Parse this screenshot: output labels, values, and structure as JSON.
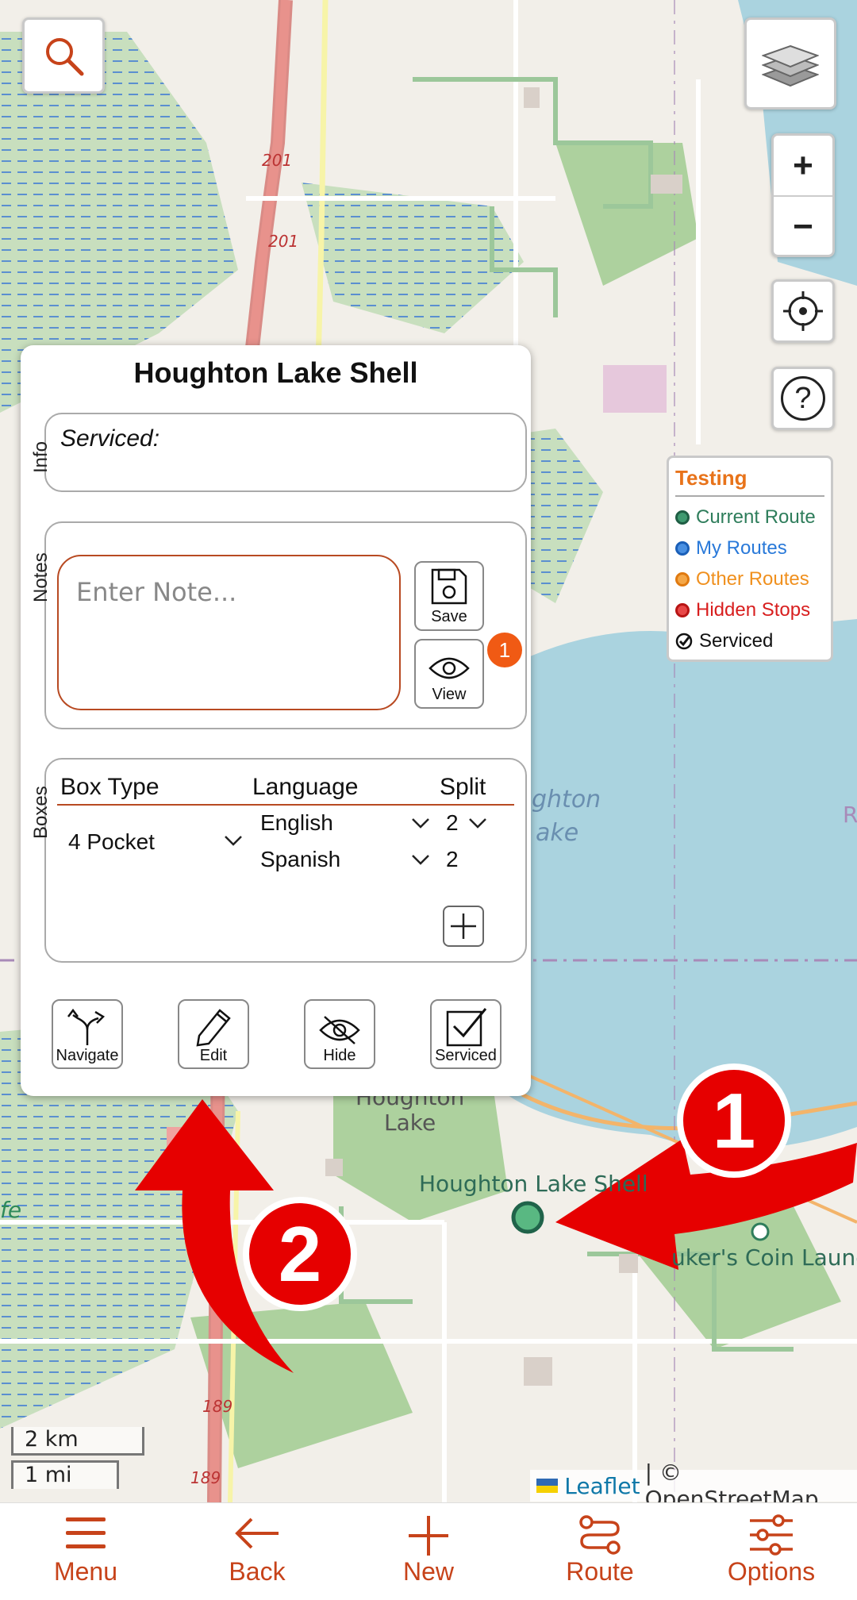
{
  "map": {
    "labels": {
      "place": "Houghton Lake Shell",
      "laundry": "uker's Coin Laundr",
      "lake1": "ghton",
      "lake2": "ake",
      "town1": "Houghton",
      "town2": "Lake",
      "road201a": "201",
      "road201b": "201",
      "road189a": "189",
      "road189b": "189",
      "marsh": "fe",
      "edge_r": "R"
    },
    "annotations": {
      "step1": "1",
      "step2": "2"
    }
  },
  "controls": {
    "search_icon": "search-icon",
    "layers_icon": "layers-icon",
    "zoom_in": "+",
    "zoom_out": "−",
    "locate_icon": "crosshair-icon",
    "help": "?"
  },
  "legend": {
    "title": "Testing",
    "items": [
      {
        "label": "Current Route",
        "color": "#2e7d5b"
      },
      {
        "label": "My Routes",
        "color": "#2979d9"
      },
      {
        "label": "Other Routes",
        "color": "#f0901e"
      },
      {
        "label": "Hidden Stops",
        "color": "#d81e1e"
      },
      {
        "label": "Serviced",
        "color": "#111111"
      }
    ]
  },
  "popup": {
    "title": "Houghton Lake Shell",
    "info": {
      "label": "Info",
      "serviced": "Serviced:"
    },
    "notes": {
      "label": "Notes",
      "placeholder": "Enter Note...",
      "save_label": "Save",
      "view_label": "View",
      "view_count": "1"
    },
    "boxes": {
      "label": "Boxes",
      "headers": {
        "type": "Box Type",
        "language": "Language",
        "split": "Split"
      },
      "box_type": "4 Pocket",
      "rows": [
        {
          "language": "English",
          "split": "2"
        },
        {
          "language": "Spanish",
          "split": "2"
        }
      ]
    },
    "actions": {
      "navigate": "Navigate",
      "edit": "Edit",
      "hide": "Hide",
      "serviced": "Serviced"
    }
  },
  "attribution": {
    "leaflet": "Leaflet",
    "rest": "| © OpenStreetMap"
  },
  "scale": {
    "km": "2 km",
    "mi": "1 mi"
  },
  "bottom_nav": {
    "menu": "Menu",
    "back": "Back",
    "new": "New",
    "route": "Route",
    "options": "Options"
  },
  "colors": {
    "accent": "#c7431a",
    "water": "#aad3df",
    "woods": "#add19e"
  }
}
